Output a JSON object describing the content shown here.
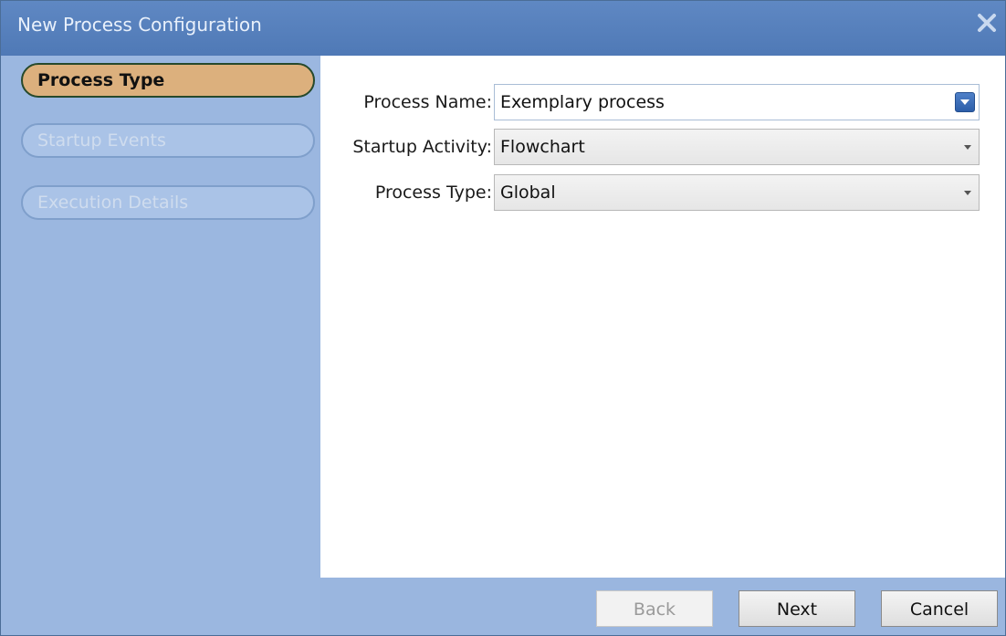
{
  "window": {
    "title": "New Process Configuration"
  },
  "icons": {
    "close": "close-icon",
    "dropdown": "chevron-down-icon"
  },
  "colors": {
    "titlebar": "#5584c0",
    "sidebar": "#9bb7e0",
    "active_step": "#dcb07d",
    "active_step_border": "#26492b"
  },
  "steps": [
    {
      "label": "Process Type",
      "state": "active"
    },
    {
      "label": "Startup Events",
      "state": "inactive"
    },
    {
      "label": "Execution Details",
      "state": "inactive"
    }
  ],
  "form": {
    "process_name": {
      "label": "Process Name:",
      "value": "Exemplary process"
    },
    "startup_activity": {
      "label": "Startup Activity:",
      "value": "Flowchart"
    },
    "process_type": {
      "label": "Process Type:",
      "value": "Global"
    }
  },
  "buttons": {
    "back": "Back",
    "next": "Next",
    "cancel": "Cancel"
  }
}
